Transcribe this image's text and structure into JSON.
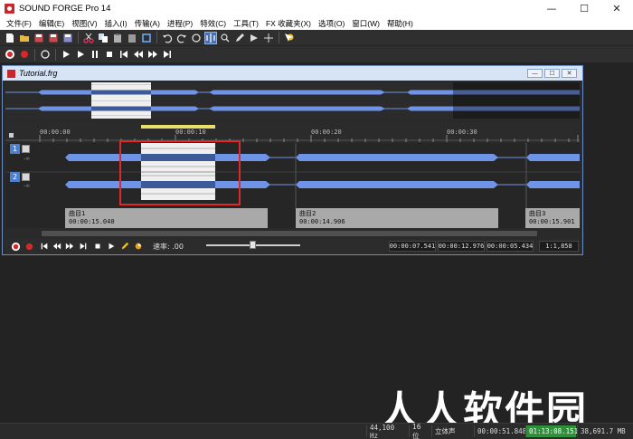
{
  "app": {
    "title": "SOUND FORGE Pro 14"
  },
  "window_controls": {
    "minimize": "—",
    "maximize": "☐",
    "close": "✕"
  },
  "menu": [
    "文件(F)",
    "编辑(E)",
    "视图(V)",
    "插入(I)",
    "传输(A)",
    "进程(P)",
    "特效(C)",
    "工具(T)",
    "FX 收藏夹(X)",
    "选项(O)",
    "窗口(W)",
    "帮助(H)"
  ],
  "document": {
    "title": "Tutorial.frg",
    "ruler_labels": [
      "00:00:00",
      "00:00:10",
      "00:00:20",
      "00:00:30"
    ],
    "channels": [
      {
        "badge": "1",
        "db": "-∞"
      },
      {
        "badge": "2",
        "db": "-∞"
      }
    ],
    "regions": [
      {
        "name": "曲目1",
        "duration": "00:00:15.040"
      },
      {
        "name": "曲目2",
        "duration": "00:00:14.906"
      },
      {
        "name": "曲目3",
        "duration": "00:00:15.901"
      }
    ],
    "transport": {
      "rate_label": "速率: .00",
      "times": [
        "00:00:07.541",
        "00:00:12.976",
        "00:00:05.434"
      ],
      "zoom": "1:1,858"
    }
  },
  "status": {
    "sample_rate": "44,100 Hz",
    "bit_depth": "16 位",
    "channels": "立体声",
    "length": "00:00:51.848",
    "record_time": "01:13:08.151",
    "disk_space": "38,691.7 MB"
  },
  "watermark": "人人软件园",
  "colors": {
    "waveform": "#6f93e6",
    "selection_box": "#e02828",
    "record_time_bg": "#2f8f3a"
  }
}
